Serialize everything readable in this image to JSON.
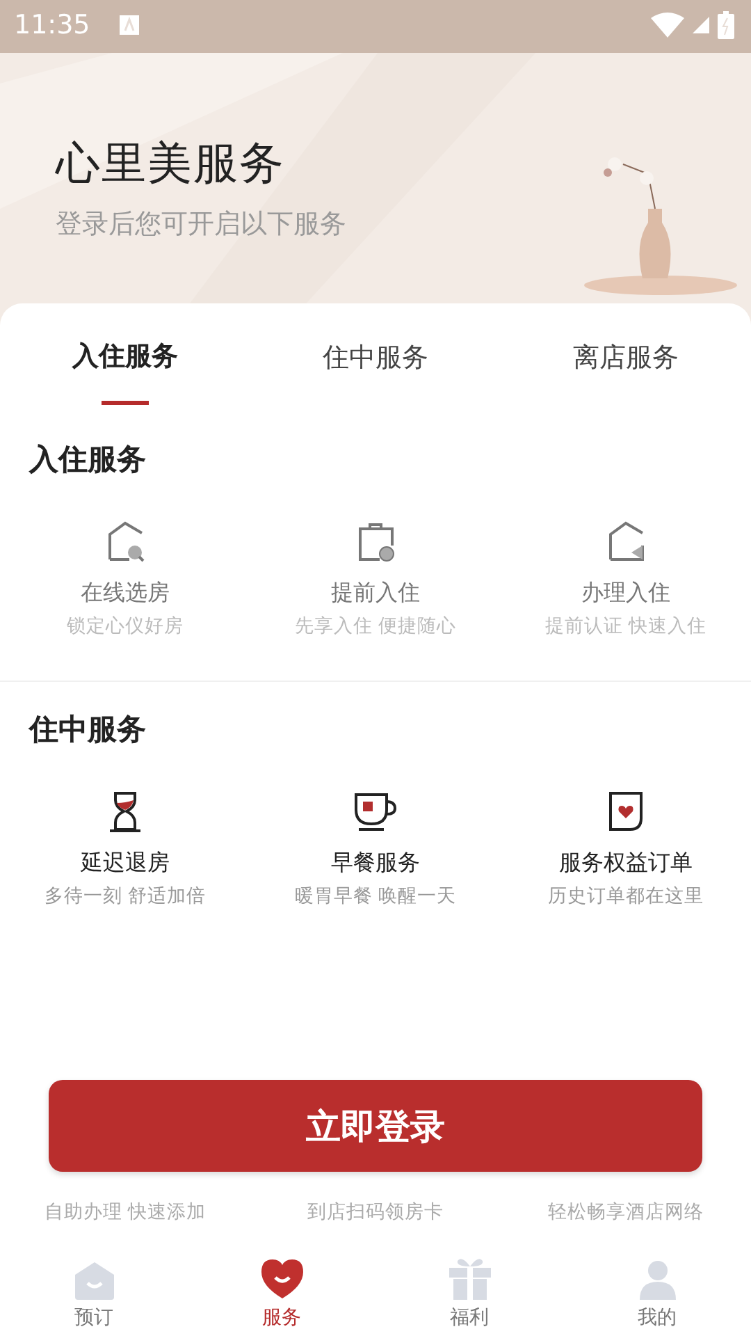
{
  "status_bar": {
    "time": "11:35"
  },
  "hero": {
    "title": "心里美服务",
    "subtitle": "登录后您可开启以下服务"
  },
  "tabs": [
    {
      "label": "入住服务",
      "selected": true
    },
    {
      "label": "住中服务",
      "selected": false
    },
    {
      "label": "离店服务",
      "selected": false
    }
  ],
  "sections": [
    {
      "title": "入住服务",
      "items": [
        {
          "title": "在线选房",
          "subtitle": "锁定心仪好房"
        },
        {
          "title": "提前入住",
          "subtitle": "先享入住 便捷随心"
        },
        {
          "title": "办理入住",
          "subtitle": "提前认证 快速入住"
        }
      ]
    },
    {
      "title": "住中服务",
      "items": [
        {
          "title": "延迟退房",
          "subtitle": "多待一刻 舒适加倍"
        },
        {
          "title": "早餐服务",
          "subtitle": "暖胃早餐 唤醒一天"
        },
        {
          "title": "服务权益订单",
          "subtitle": "历史订单都在这里"
        }
      ]
    }
  ],
  "covered_items": [
    {
      "subtitle": "自助办理 快速添加"
    },
    {
      "subtitle": "到店扫码领房卡"
    },
    {
      "subtitle": "轻松畅享酒店网络"
    }
  ],
  "login_button": {
    "label": "立即登录"
  },
  "nav": [
    {
      "label": "预订",
      "selected": false
    },
    {
      "label": "服务",
      "selected": true
    },
    {
      "label": "福利",
      "selected": false
    },
    {
      "label": "我的",
      "selected": false
    }
  ]
}
